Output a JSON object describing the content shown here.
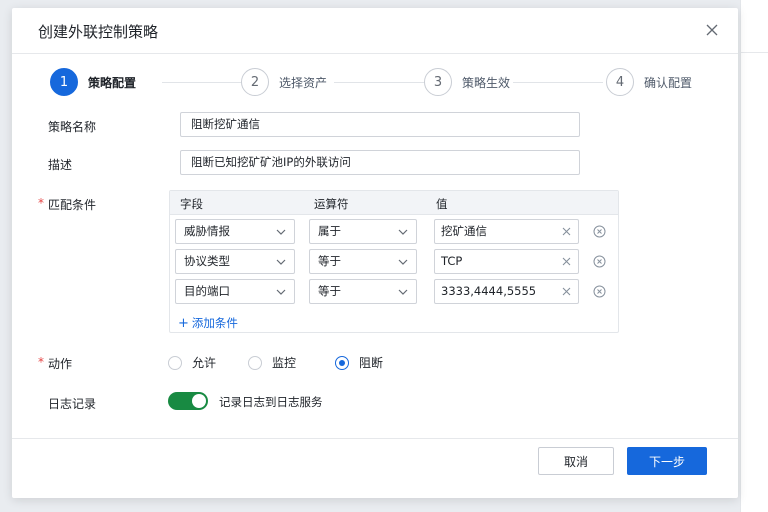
{
  "dialog": {
    "title": "创建外联控制策略"
  },
  "steps": [
    {
      "number": "1",
      "label": "策略配置",
      "active": true
    },
    {
      "number": "2",
      "label": "选择资产",
      "active": false
    },
    {
      "number": "3",
      "label": "策略生效",
      "active": false
    },
    {
      "number": "4",
      "label": "确认配置",
      "active": false
    }
  ],
  "form": {
    "name_label": "策略名称",
    "name_value": "阻断挖矿通信",
    "desc_label": "描述",
    "desc_value": "阻断已知挖矿矿池IP的外联访问",
    "conditions_label": "匹配条件",
    "conditions": {
      "headers": {
        "field": "字段",
        "operator": "运算符",
        "value": "值"
      },
      "rows": [
        {
          "field": "威胁情报",
          "operator": "属于",
          "value": "挖矿通信"
        },
        {
          "field": "协议类型",
          "operator": "等于",
          "value": "TCP"
        },
        {
          "field": "目的端口",
          "operator": "等于",
          "value": "3333,4444,5555"
        }
      ],
      "add_label": "添加条件"
    },
    "action_label": "动作",
    "actions": [
      {
        "label": "允许",
        "checked": false
      },
      {
        "label": "监控",
        "checked": false
      },
      {
        "label": "阻断",
        "checked": true
      }
    ],
    "log_label": "日志记录",
    "log_enabled": true,
    "log_toggle_label": "记录日志到日志服务"
  },
  "footer": {
    "cancel_label": "取消",
    "next_label": "下一步"
  },
  "colors": {
    "primary": "#1668dc",
    "toggle_on": "#188a42",
    "required": "#e54545"
  }
}
